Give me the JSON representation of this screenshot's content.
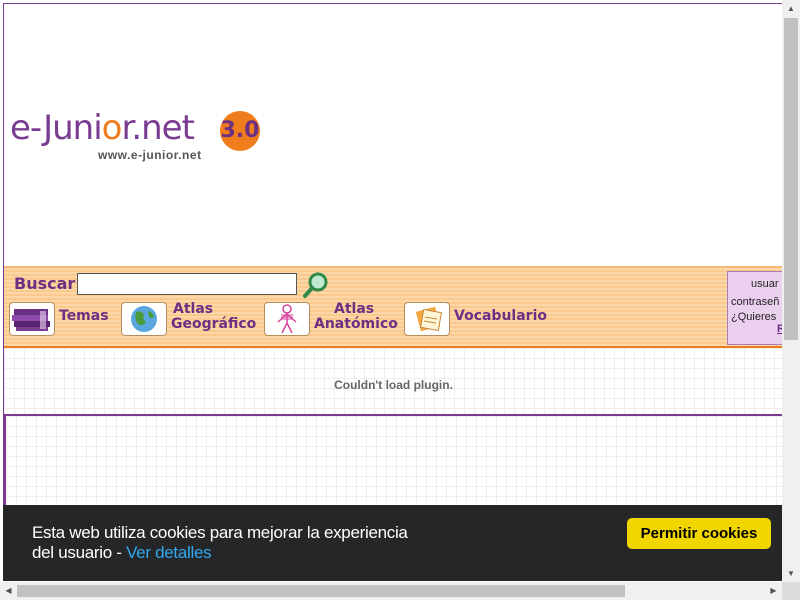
{
  "logo": {
    "brand_prefix": "e-Juni",
    "brand_o": "o",
    "brand_suffix": "r.net",
    "version": "3.0",
    "url": "www.e-junior.net"
  },
  "search": {
    "label": "Buscar",
    "value": "",
    "placeholder": ""
  },
  "nav": {
    "items": [
      {
        "label_line1": "Temas",
        "label_line2": "",
        "icon": "books-icon"
      },
      {
        "label_line1": "Atlas",
        "label_line2": "Geográfico",
        "icon": "globe-icon"
      },
      {
        "label_line1": "Atlas",
        "label_line2": "Anatómico",
        "icon": "skeleton-icon"
      },
      {
        "label_line1": "Vocabulario",
        "label_line2": "",
        "icon": "notebook-icon"
      }
    ]
  },
  "login": {
    "line1": "usuar",
    "line2": "contraseñ",
    "line3": "¿Quieres",
    "link": "R"
  },
  "plugin": {
    "message": "Couldn't load plugin."
  },
  "cookie": {
    "text": "Esta web utiliza cookies para mejorar la experiencia del usuario - ",
    "link": "Ver detalles",
    "button": "Permitir cookies"
  },
  "colors": {
    "brand_purple": "#7a3c91",
    "brand_orange": "#f07d1c",
    "cookie_bg": "#252627",
    "cookie_button": "#f1d600",
    "cookie_link": "#31a8f0"
  }
}
